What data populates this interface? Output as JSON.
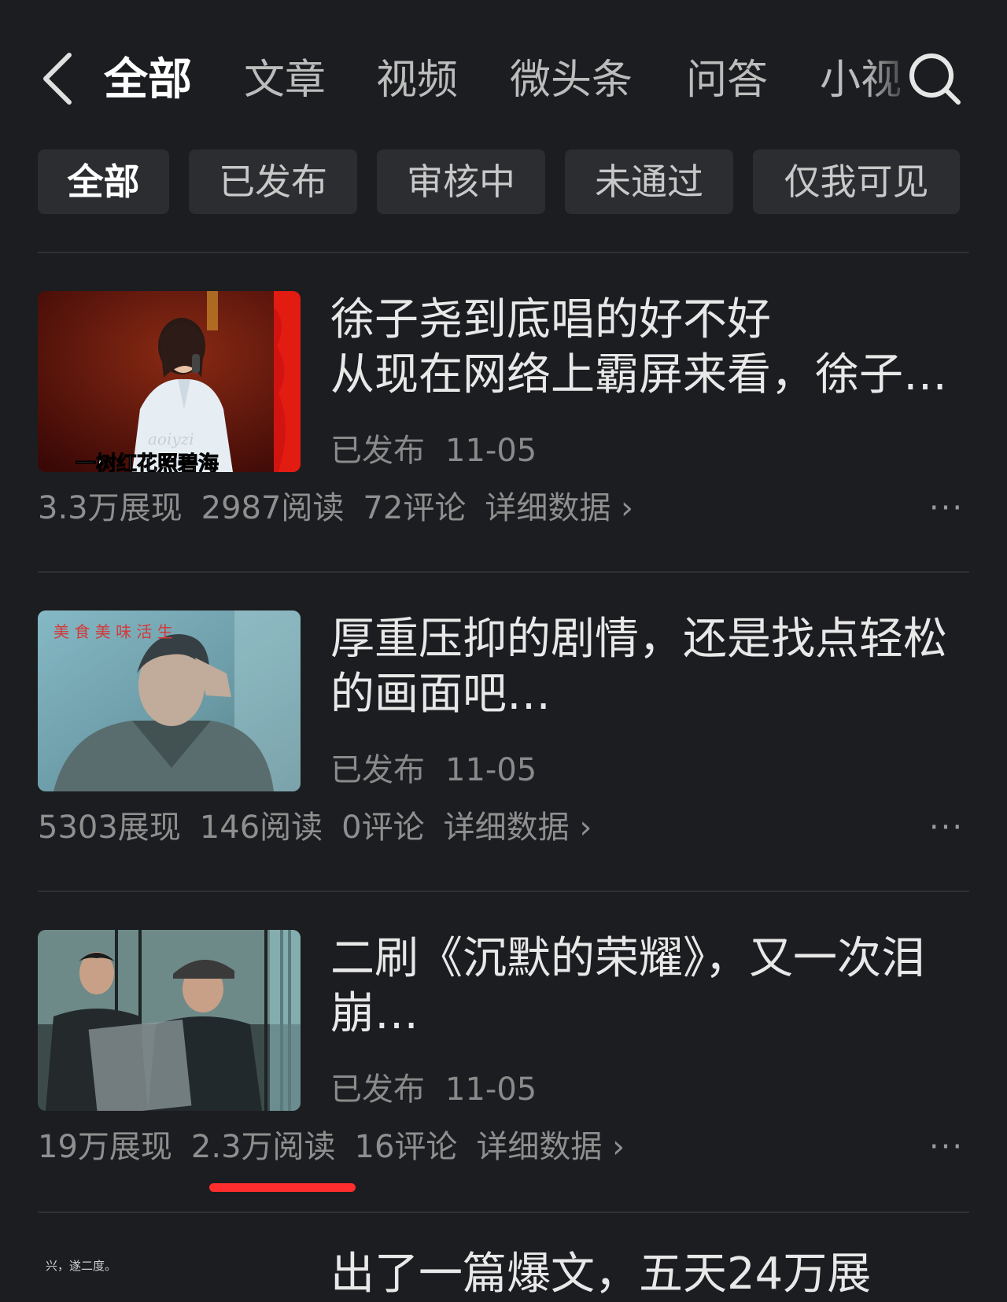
{
  "nav": {
    "tabs": [
      {
        "label": "全部",
        "active": true
      },
      {
        "label": "文章",
        "active": false
      },
      {
        "label": "视频",
        "active": false
      },
      {
        "label": "微头条",
        "active": false
      },
      {
        "label": "问答",
        "active": false
      },
      {
        "label": "小视",
        "active": false
      }
    ]
  },
  "filters": [
    {
      "label": "全部",
      "active": true
    },
    {
      "label": "已发布",
      "active": false
    },
    {
      "label": "审核中",
      "active": false
    },
    {
      "label": "未通过",
      "active": false
    },
    {
      "label": "仅我可见",
      "active": false
    }
  ],
  "articles": [
    {
      "title_line1": "徐子尧到底唱的好不好",
      "title_line2": "从现在网络上霸屏来看，徐子…",
      "status": "已发布",
      "date": "11-05",
      "impressions": "3.3万展现",
      "reads": "2987阅读",
      "comments": "72评论",
      "detail": "详细数据 ›",
      "thumb_caption": "一树红花照碧海",
      "thumb_watermark": "aoiyzi"
    },
    {
      "title_line1": "厚重压抑的剧情，还是找点轻松",
      "title_line2": "的画面吧…",
      "status": "已发布",
      "date": "11-05",
      "impressions": "5303展现",
      "reads": "146阅读",
      "comments": "0评论",
      "detail": "详细数据 ›",
      "thumb_overlay_text": "美 食 美 味 活 生"
    },
    {
      "title_line1": "二刷《沉默的荣耀》，又一次泪",
      "title_line2": "崩…",
      "status": "已发布",
      "date": "11-05",
      "impressions": "19万展现",
      "reads": "2.3万阅读",
      "comments": "16评论",
      "detail": "详细数据 ›"
    }
  ],
  "partial_article": {
    "title": "出了一篇爆文，五天24万展",
    "thumb_text": "兴，遂二度。"
  },
  "more_label": "···",
  "colors": {
    "background": "#1c1d20",
    "chip_bg": "#2c2d31",
    "highlight_underline": "#ff2d2d"
  }
}
